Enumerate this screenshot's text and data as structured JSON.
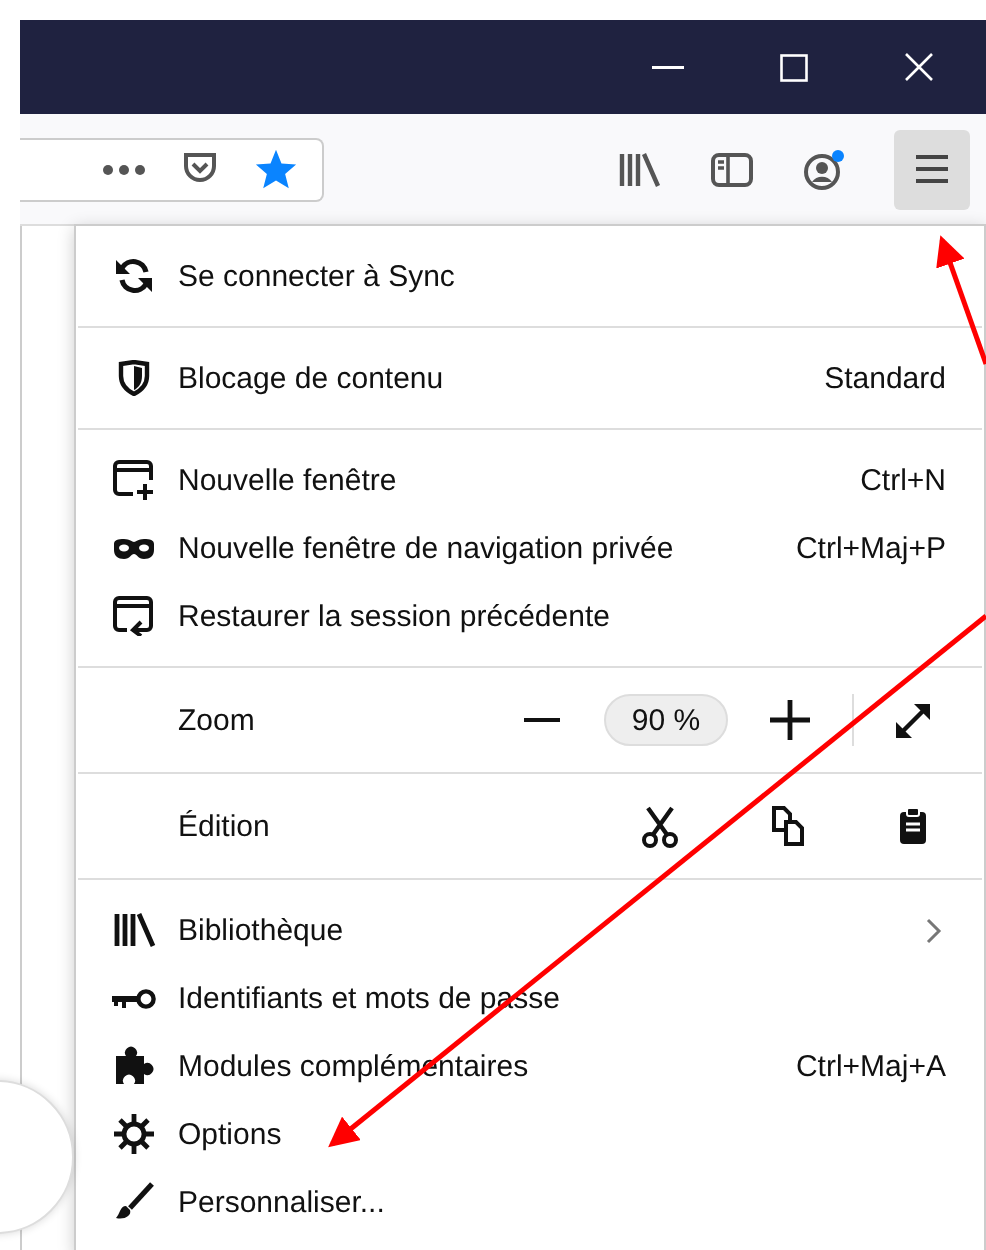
{
  "menu": {
    "sections": [
      {
        "rows": [
          {
            "kind": "item",
            "label": "Se connecter à Sync",
            "submenu": false
          }
        ]
      },
      {
        "rows": [
          {
            "kind": "item",
            "label": "Blocage de contenu",
            "shortcut": "Standard",
            "submenu": false
          }
        ]
      },
      {
        "rows": [
          {
            "kind": "item",
            "label": "Nouvelle fenêtre",
            "shortcut": "Ctrl+N",
            "submenu": false
          },
          {
            "kind": "item",
            "label": "Nouvelle fenêtre de navigation privée",
            "shortcut": "Ctrl+Maj+P",
            "submenu": false
          },
          {
            "kind": "item",
            "label": "Restaurer la session précédente",
            "submenu": false
          }
        ]
      },
      {
        "rows": [
          {
            "kind": "zoom",
            "label": "Zoom",
            "value": "90 %"
          }
        ]
      },
      {
        "rows": [
          {
            "kind": "edit",
            "label": "Édition"
          }
        ]
      },
      {
        "rows": [
          {
            "kind": "item",
            "label": "Bibliothèque",
            "submenu": true
          },
          {
            "kind": "item",
            "label": "Identifiants et mots de passe",
            "submenu": false
          },
          {
            "kind": "item",
            "label": "Modules complémentaires",
            "shortcut": "Ctrl+Maj+A",
            "submenu": false
          },
          {
            "kind": "item",
            "label": "Options",
            "submenu": false
          },
          {
            "kind": "item",
            "label": "Personnaliser...",
            "submenu": false
          }
        ]
      }
    ]
  }
}
